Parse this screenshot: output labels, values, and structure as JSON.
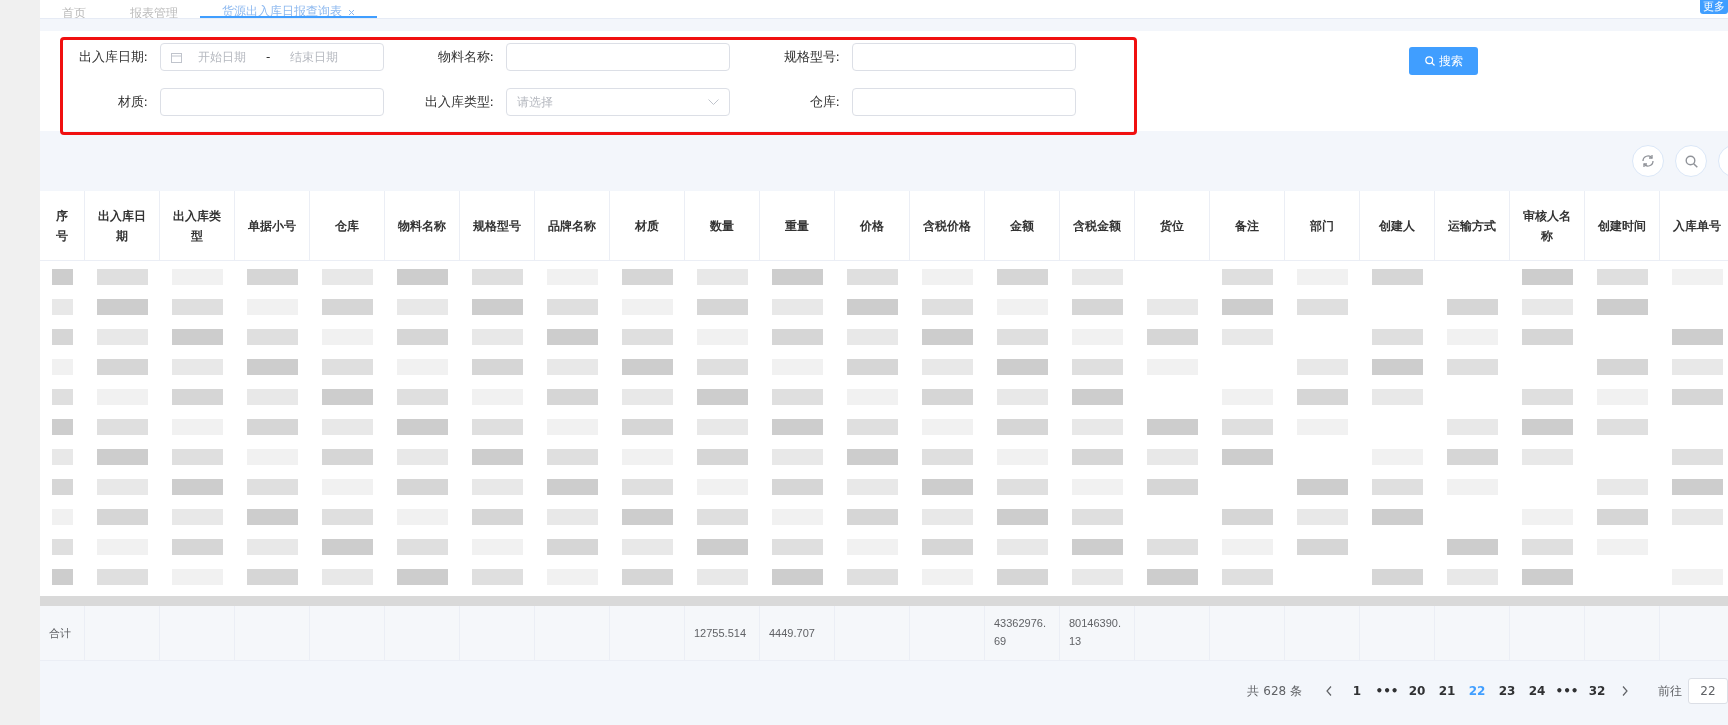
{
  "tabs": [
    {
      "label": "首页",
      "selected": false,
      "closable": false
    },
    {
      "label": "报表管理",
      "selected": false,
      "closable": false
    },
    {
      "label": "货源出入库日报查询表",
      "selected": true,
      "closable": true
    }
  ],
  "more_button": "更多",
  "filters": [
    {
      "kind": "daterange",
      "label": "出入库日期:",
      "start_placeholder": "开始日期",
      "separator": "-",
      "end_placeholder": "结束日期"
    },
    {
      "kind": "text",
      "label": "物料名称:"
    },
    {
      "kind": "text",
      "label": "规格型号:"
    },
    {
      "kind": "text",
      "label": "材质:"
    },
    {
      "kind": "select",
      "label": "出入库类型:",
      "placeholder": "请选择"
    },
    {
      "kind": "text",
      "label": "仓库:"
    }
  ],
  "search_button": "搜索",
  "table": {
    "columns": [
      {
        "header": "序号",
        "total": "合计"
      },
      {
        "header": "出入库日期"
      },
      {
        "header": "出入库类型"
      },
      {
        "header": "单据小号"
      },
      {
        "header": "仓库"
      },
      {
        "header": "物料名称"
      },
      {
        "header": "规格型号"
      },
      {
        "header": "品牌名称"
      },
      {
        "header": "材质"
      },
      {
        "header": "数量",
        "total": "12755.514"
      },
      {
        "header": "重量",
        "total": "4449.707"
      },
      {
        "header": "价格"
      },
      {
        "header": "含税价格"
      },
      {
        "header": "金额",
        "total": "43362976.69"
      },
      {
        "header": "含税金额",
        "total": "80146390.13"
      },
      {
        "header": "货位"
      },
      {
        "header": "备注"
      },
      {
        "header": "部门"
      },
      {
        "header": "创建人"
      },
      {
        "header": "运输方式"
      },
      {
        "header": "审核人名称"
      },
      {
        "header": "创建时间"
      },
      {
        "header": "入库单号"
      }
    ]
  },
  "pagination": {
    "total": "共 628 条",
    "pages": [
      {
        "label": "1",
        "selected": false
      },
      {
        "label": "•••",
        "selected": false
      },
      {
        "label": "20",
        "selected": false
      },
      {
        "label": "21",
        "selected": false
      },
      {
        "label": "22",
        "selected": true
      },
      {
        "label": "23",
        "selected": false
      },
      {
        "label": "24",
        "selected": false
      },
      {
        "label": "•••",
        "selected": false
      },
      {
        "label": "32",
        "selected": false
      }
    ],
    "goto_label": "前往",
    "goto_value": "22"
  }
}
